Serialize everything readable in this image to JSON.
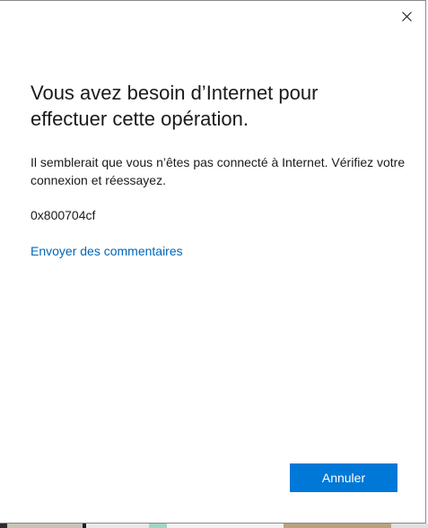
{
  "dialog": {
    "title": "Vous avez besoin d’Internet pour effectuer cette opération.",
    "message": "Il semblerait que vous n’êtes pas connecté à Internet. Vérifiez votre connexion et réessayez.",
    "error_code": "0x800704cf",
    "feedback_link": "Envoyer des commentaires",
    "cancel_label": "Annuler",
    "close_icon": "close-icon"
  },
  "colors": {
    "accent": "#0078d7",
    "link": "#0067b8",
    "text": "#1a1a1a",
    "background": "#ffffff"
  }
}
